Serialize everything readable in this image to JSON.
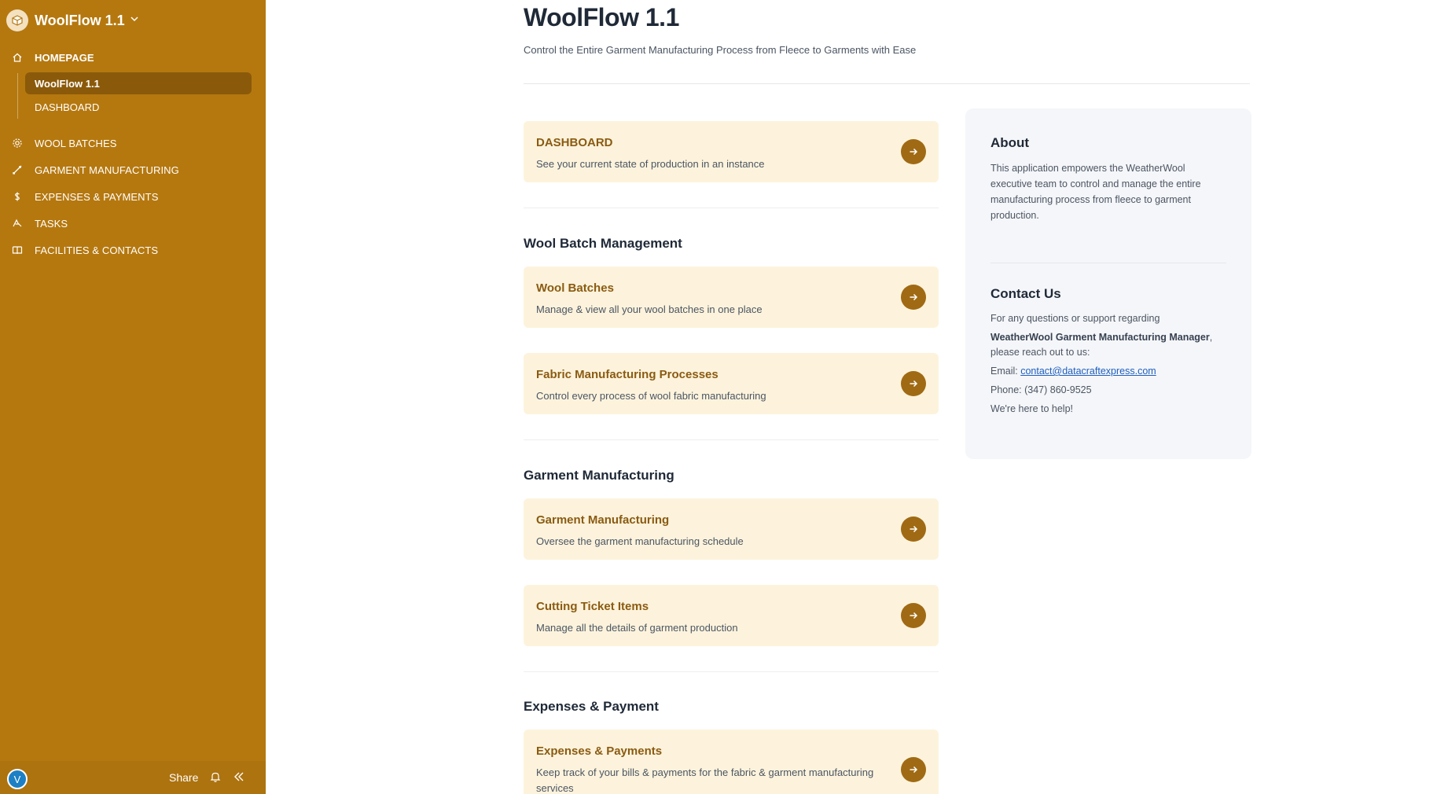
{
  "sidebar": {
    "brand": {
      "title": "WoolFlow 1.1"
    },
    "nav": {
      "homepage": "HOMEPAGE",
      "sub": [
        "WoolFlow 1.1",
        "DASHBOARD"
      ],
      "wool_batches": "WOOL BATCHES",
      "garment_manufacturing": "GARMENT MANUFACTURING",
      "expenses_payments": "EXPENSES & PAYMENTS",
      "tasks": "TASKS",
      "facilities_contacts": "FACILITIES & CONTACTS"
    },
    "footer": {
      "avatar_initial": "V",
      "share_label": "Share"
    }
  },
  "main": {
    "title": "WoolFlow 1.1",
    "subtitle": "Control the Entire Garment Manufacturing Process from Fleece to Garments with Ease",
    "cards": {
      "dashboard": {
        "title": "DASHBOARD",
        "desc": "See your current state of production in an instance"
      },
      "wool_batches": {
        "title": "Wool Batches",
        "desc": "Manage & view all your wool batches in one place"
      },
      "fabric_processes": {
        "title": "Fabric Manufacturing Processes",
        "desc": "Control every process of wool fabric manufacturing"
      },
      "garment_manufacturing": {
        "title": "Garment Manufacturing",
        "desc": "Oversee the garment manufacturing schedule"
      },
      "cutting_ticket": {
        "title": "Cutting Ticket Items",
        "desc": "Manage all the details of garment production"
      },
      "expenses_payments": {
        "title": "Expenses & Payments",
        "desc": "Keep track of your bills & payments for the fabric & garment manufacturing services"
      }
    },
    "sections": {
      "wool_batch_mgmt": "Wool Batch Management",
      "garment_mfg": "Garment Manufacturing",
      "expenses_payment": "Expenses & Payment"
    }
  },
  "panel": {
    "about_title": "About",
    "about_text": "This application empowers the WeatherWool executive team to control and manage the entire manufacturing process from fleece to garment production.",
    "contact_title": "Contact Us",
    "contact_intro": "For any questions or support regarding",
    "contact_strong": "WeatherWool Garment Manufacturing Manager",
    "contact_comma": ",",
    "contact_reach": "please reach out to us:",
    "email_label": "Email: ",
    "email": "contact@datacraftexpress.com",
    "phone": "Phone: (347) 860-9525",
    "help": "We're here to help!"
  },
  "colors": {
    "sidebar_bg": "#b5780f",
    "card_bg": "#fdf3dc",
    "card_title": "#8a5b12",
    "arrow_button": "#a06a14",
    "panel_bg": "#f5f6f9"
  },
  "icons": [
    "app-logo-icon",
    "chevron-down-icon",
    "home-icon",
    "gear-icon",
    "needle-icon",
    "dollar-icon",
    "tasks-icon",
    "book-icon",
    "bell-icon",
    "collapse-icon",
    "arrow-right-icon"
  ]
}
